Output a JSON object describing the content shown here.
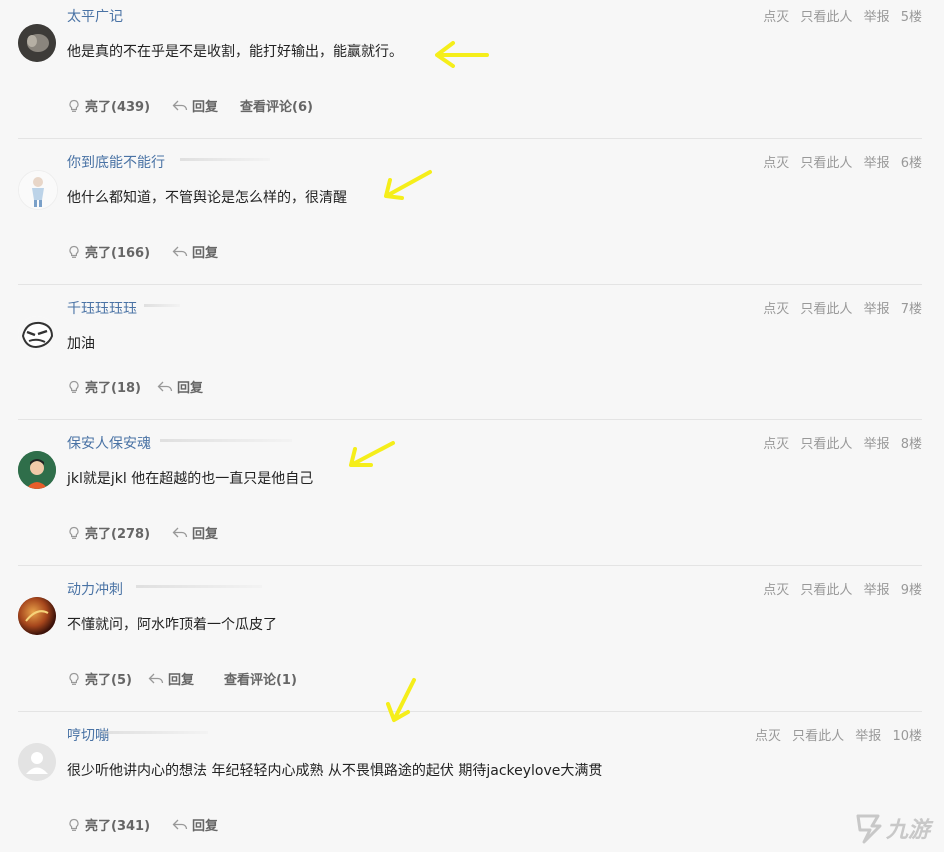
{
  "meta_labels": {
    "downvote": "点灭",
    "only_author": "只看此人",
    "report": "举报"
  },
  "actions": {
    "reply": "回复"
  },
  "posts": [
    {
      "user": "太平广记",
      "content": "他是真的不在乎是不是收割，能打好输出，能赢就行。",
      "floor": "5楼",
      "likes": "亮了(439)",
      "view_comments": "查看评论(6)"
    },
    {
      "user": "你到底能不能行",
      "content": "他什么都知道，不管舆论是怎么样的，很清醒",
      "floor": "6楼",
      "likes": "亮了(166)",
      "view_comments": ""
    },
    {
      "user": "千珏珏珏珏",
      "content": "加油",
      "floor": "7楼",
      "likes": "亮了(18)",
      "view_comments": ""
    },
    {
      "user": "保安人保安魂",
      "content": "jkl就是jkl 他在超越的也一直只是他自己",
      "floor": "8楼",
      "likes": "亮了(278)",
      "view_comments": ""
    },
    {
      "user": "动力冲刺",
      "content": "不懂就问，阿水咋顶着一个瓜皮了",
      "floor": "9楼",
      "likes": "亮了(5)",
      "view_comments": "查看评论(1)"
    },
    {
      "user": "哼切嘣",
      "content": "很少听他讲内心的想法 年纪轻轻内心成熟 从不畏惧路途的起伏 期待jackeylove大满贯",
      "floor": "10楼",
      "likes": "亮了(341)",
      "view_comments": ""
    }
  ],
  "colors": {
    "username": "#4a73a5",
    "arrow": "#f5ee1a",
    "meta": "#999999"
  },
  "watermark": "九游"
}
